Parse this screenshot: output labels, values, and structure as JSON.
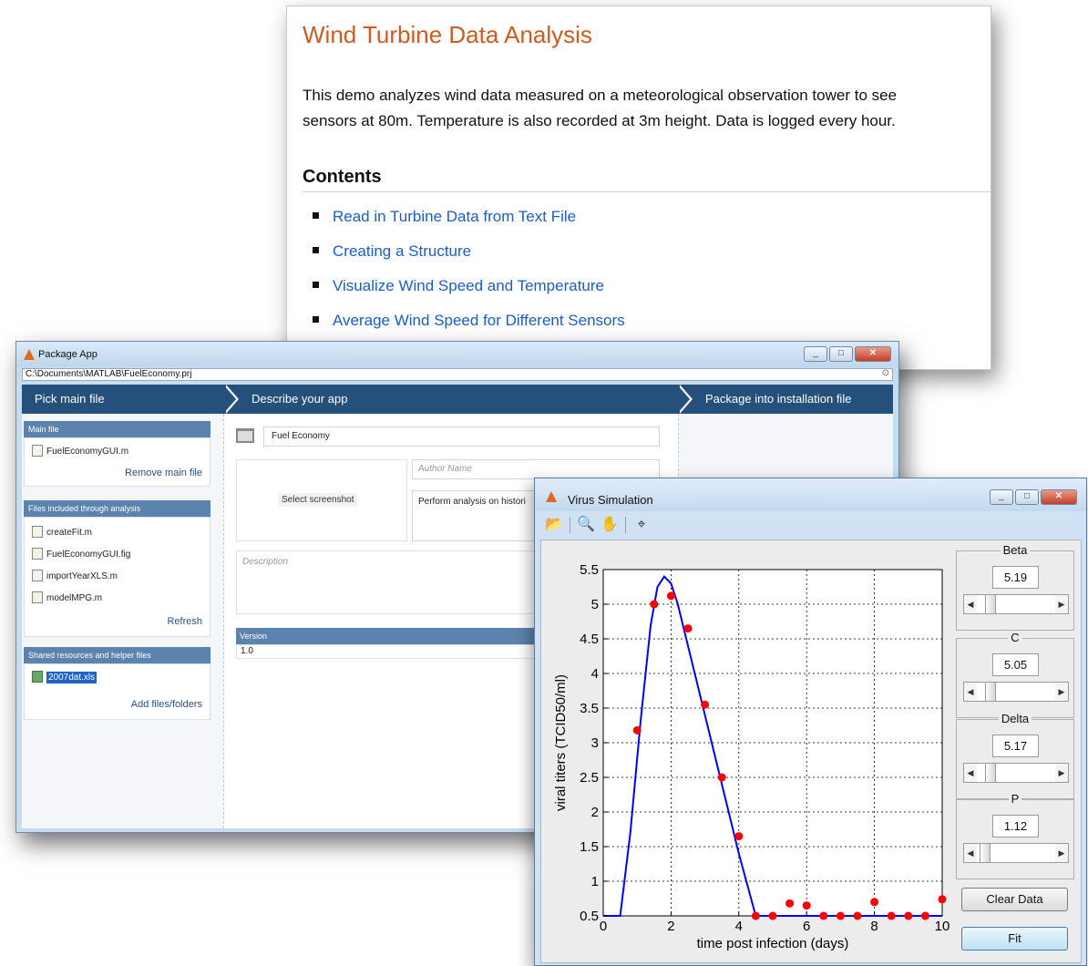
{
  "doc": {
    "title": "Wind Turbine Data Analysis",
    "para_line1": "This demo analyzes wind data measured on a meteorological observation tower to see",
    "para_line2": "sensors at 80m. Temperature is also recorded at 3m height. Data is logged every hour.",
    "contents_heading": "Contents",
    "toc": [
      "Read in Turbine Data from Text File",
      "Creating a Structure",
      "Visualize Wind Speed and Temperature",
      "Average Wind Speed for Different Sensors"
    ]
  },
  "package_app": {
    "title": "Package App",
    "path": "C:\\Documents\\MATLAB\\FuelEconomy.prj",
    "steps": [
      "Pick main file",
      "Describe your app",
      "Package into installation file"
    ],
    "main_file": {
      "header": "Main file",
      "file": "FuelEconomyGUI.m",
      "remove_link": "Remove main file"
    },
    "analysis_files": {
      "header": "Files included through analysis",
      "files": [
        "createFit.m",
        "FuelEconomyGUI.fig",
        "importYearXLS.m",
        "modelMPG.m"
      ],
      "refresh_link": "Refresh"
    },
    "shared": {
      "header": "Shared resources and helper files",
      "file": "2007dat.xls",
      "add_link": "Add files/folders"
    },
    "app_name": "Fuel Economy",
    "select_screenshot": "Select screenshot",
    "author_placeholder": "Author Name",
    "summary": "Perform analysis on histori",
    "description_placeholder": "Description",
    "version_header": "Version",
    "version": "1.0"
  },
  "virus_sim": {
    "title": "Virus Simulation",
    "toolbar": [
      "open-folder-icon",
      "zoom-in-icon",
      "pan-hand-icon",
      "data-cursor-icon"
    ],
    "controls": [
      {
        "name": "Beta",
        "value": "5.19",
        "slider": 0.12
      },
      {
        "name": "C",
        "value": "5.05",
        "slider": 0.12
      },
      {
        "name": "Delta",
        "value": "5.17",
        "slider": 0.12
      },
      {
        "name": "P",
        "value": "1.12",
        "slider": 0.04
      }
    ],
    "clear_button": "Clear Data",
    "fit_button": "Fit"
  },
  "chart_data": {
    "type": "scatter",
    "title": "",
    "xlabel": "time post infection (days)",
    "ylabel": "viral titers (TCID50/ml)",
    "xlim": [
      0,
      10
    ],
    "ylim": [
      0.5,
      5.5
    ],
    "xticks": [
      0,
      2,
      4,
      6,
      8,
      10
    ],
    "yticks": [
      0.5,
      1,
      1.5,
      2,
      2.5,
      3,
      3.5,
      4,
      4.5,
      5,
      5.5
    ],
    "grid": true,
    "series": [
      {
        "kind": "points",
        "color": "#ff0000",
        "x": [
          1,
          1.5,
          2,
          2.5,
          3,
          3.5,
          4,
          4.5,
          5,
          5.5,
          6,
          6.5,
          7,
          7.5,
          8,
          8.5,
          9,
          9.5,
          10
        ],
        "y": [
          3.18,
          5.0,
          5.12,
          4.65,
          3.55,
          2.5,
          1.65,
          0.5,
          0.5,
          0.68,
          0.65,
          0.5,
          0.5,
          0.5,
          0.7,
          0.5,
          0.5,
          0.5,
          0.74
        ]
      },
      {
        "kind": "line",
        "color": "#0000ff",
        "x": [
          0,
          0.5,
          0.8,
          1.1,
          1.4,
          1.6,
          1.8,
          2.0,
          2.2,
          2.5,
          3.0,
          3.5,
          4.0,
          4.5,
          5,
          6,
          7,
          8,
          9,
          10
        ],
        "y": [
          0.5,
          0.5,
          1.7,
          3.3,
          4.7,
          5.25,
          5.4,
          5.3,
          5.0,
          4.4,
          3.4,
          2.4,
          1.4,
          0.5,
          0.5,
          0.5,
          0.5,
          0.5,
          0.5,
          0.5
        ]
      }
    ]
  }
}
